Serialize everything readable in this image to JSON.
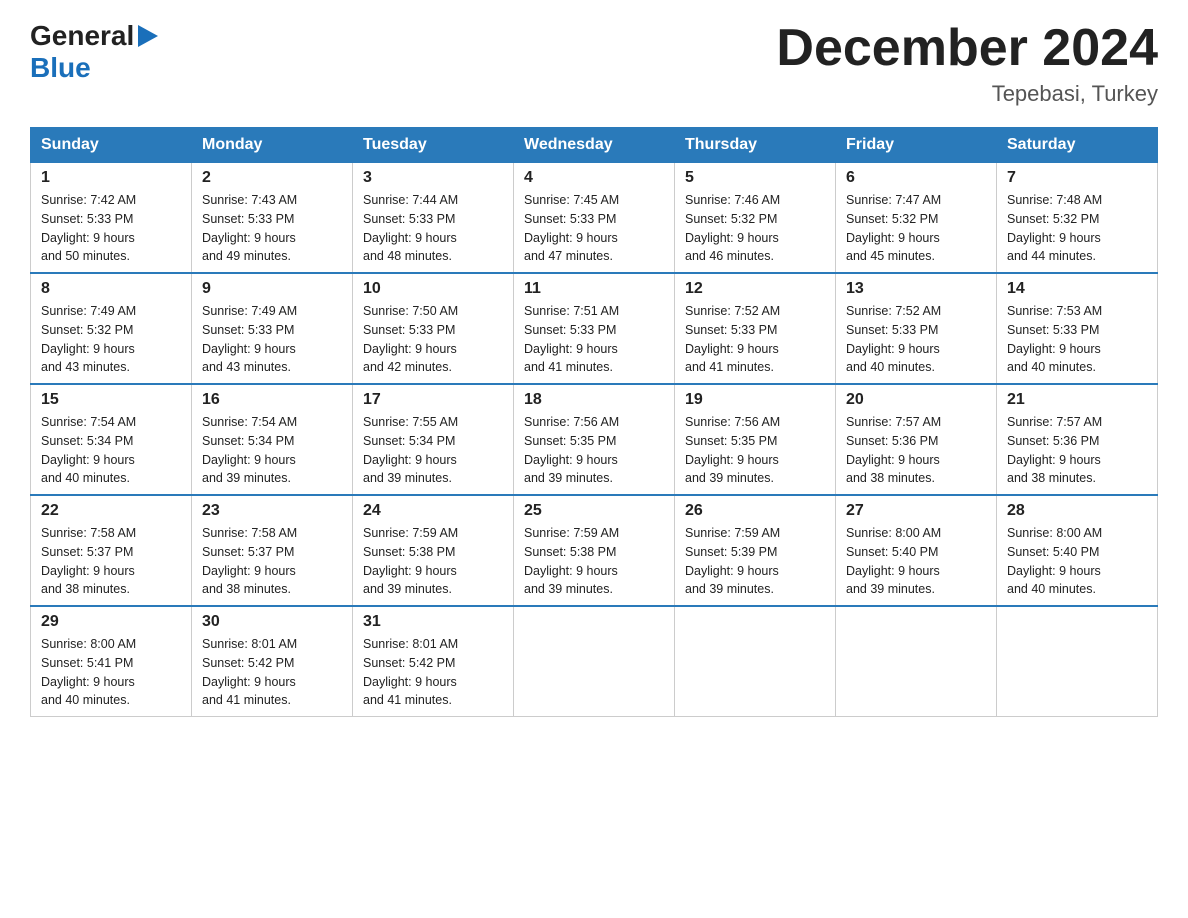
{
  "logo": {
    "general": "General",
    "blue": "Blue",
    "arrow": "▶"
  },
  "title": "December 2024",
  "location": "Tepebasi, Turkey",
  "days_header": [
    "Sunday",
    "Monday",
    "Tuesday",
    "Wednesday",
    "Thursday",
    "Friday",
    "Saturday"
  ],
  "weeks": [
    [
      {
        "day": "1",
        "sunrise": "7:42 AM",
        "sunset": "5:33 PM",
        "daylight": "9 hours and 50 minutes."
      },
      {
        "day": "2",
        "sunrise": "7:43 AM",
        "sunset": "5:33 PM",
        "daylight": "9 hours and 49 minutes."
      },
      {
        "day": "3",
        "sunrise": "7:44 AM",
        "sunset": "5:33 PM",
        "daylight": "9 hours and 48 minutes."
      },
      {
        "day": "4",
        "sunrise": "7:45 AM",
        "sunset": "5:33 PM",
        "daylight": "9 hours and 47 minutes."
      },
      {
        "day": "5",
        "sunrise": "7:46 AM",
        "sunset": "5:32 PM",
        "daylight": "9 hours and 46 minutes."
      },
      {
        "day": "6",
        "sunrise": "7:47 AM",
        "sunset": "5:32 PM",
        "daylight": "9 hours and 45 minutes."
      },
      {
        "day": "7",
        "sunrise": "7:48 AM",
        "sunset": "5:32 PM",
        "daylight": "9 hours and 44 minutes."
      }
    ],
    [
      {
        "day": "8",
        "sunrise": "7:49 AM",
        "sunset": "5:32 PM",
        "daylight": "9 hours and 43 minutes."
      },
      {
        "day": "9",
        "sunrise": "7:49 AM",
        "sunset": "5:33 PM",
        "daylight": "9 hours and 43 minutes."
      },
      {
        "day": "10",
        "sunrise": "7:50 AM",
        "sunset": "5:33 PM",
        "daylight": "9 hours and 42 minutes."
      },
      {
        "day": "11",
        "sunrise": "7:51 AM",
        "sunset": "5:33 PM",
        "daylight": "9 hours and 41 minutes."
      },
      {
        "day": "12",
        "sunrise": "7:52 AM",
        "sunset": "5:33 PM",
        "daylight": "9 hours and 41 minutes."
      },
      {
        "day": "13",
        "sunrise": "7:52 AM",
        "sunset": "5:33 PM",
        "daylight": "9 hours and 40 minutes."
      },
      {
        "day": "14",
        "sunrise": "7:53 AM",
        "sunset": "5:33 PM",
        "daylight": "9 hours and 40 minutes."
      }
    ],
    [
      {
        "day": "15",
        "sunrise": "7:54 AM",
        "sunset": "5:34 PM",
        "daylight": "9 hours and 40 minutes."
      },
      {
        "day": "16",
        "sunrise": "7:54 AM",
        "sunset": "5:34 PM",
        "daylight": "9 hours and 39 minutes."
      },
      {
        "day": "17",
        "sunrise": "7:55 AM",
        "sunset": "5:34 PM",
        "daylight": "9 hours and 39 minutes."
      },
      {
        "day": "18",
        "sunrise": "7:56 AM",
        "sunset": "5:35 PM",
        "daylight": "9 hours and 39 minutes."
      },
      {
        "day": "19",
        "sunrise": "7:56 AM",
        "sunset": "5:35 PM",
        "daylight": "9 hours and 39 minutes."
      },
      {
        "day": "20",
        "sunrise": "7:57 AM",
        "sunset": "5:36 PM",
        "daylight": "9 hours and 38 minutes."
      },
      {
        "day": "21",
        "sunrise": "7:57 AM",
        "sunset": "5:36 PM",
        "daylight": "9 hours and 38 minutes."
      }
    ],
    [
      {
        "day": "22",
        "sunrise": "7:58 AM",
        "sunset": "5:37 PM",
        "daylight": "9 hours and 38 minutes."
      },
      {
        "day": "23",
        "sunrise": "7:58 AM",
        "sunset": "5:37 PM",
        "daylight": "9 hours and 38 minutes."
      },
      {
        "day": "24",
        "sunrise": "7:59 AM",
        "sunset": "5:38 PM",
        "daylight": "9 hours and 39 minutes."
      },
      {
        "day": "25",
        "sunrise": "7:59 AM",
        "sunset": "5:38 PM",
        "daylight": "9 hours and 39 minutes."
      },
      {
        "day": "26",
        "sunrise": "7:59 AM",
        "sunset": "5:39 PM",
        "daylight": "9 hours and 39 minutes."
      },
      {
        "day": "27",
        "sunrise": "8:00 AM",
        "sunset": "5:40 PM",
        "daylight": "9 hours and 39 minutes."
      },
      {
        "day": "28",
        "sunrise": "8:00 AM",
        "sunset": "5:40 PM",
        "daylight": "9 hours and 40 minutes."
      }
    ],
    [
      {
        "day": "29",
        "sunrise": "8:00 AM",
        "sunset": "5:41 PM",
        "daylight": "9 hours and 40 minutes."
      },
      {
        "day": "30",
        "sunrise": "8:01 AM",
        "sunset": "5:42 PM",
        "daylight": "9 hours and 41 minutes."
      },
      {
        "day": "31",
        "sunrise": "8:01 AM",
        "sunset": "5:42 PM",
        "daylight": "9 hours and 41 minutes."
      },
      null,
      null,
      null,
      null
    ]
  ],
  "labels": {
    "sunrise": "Sunrise:",
    "sunset": "Sunset:",
    "daylight": "Daylight:"
  }
}
